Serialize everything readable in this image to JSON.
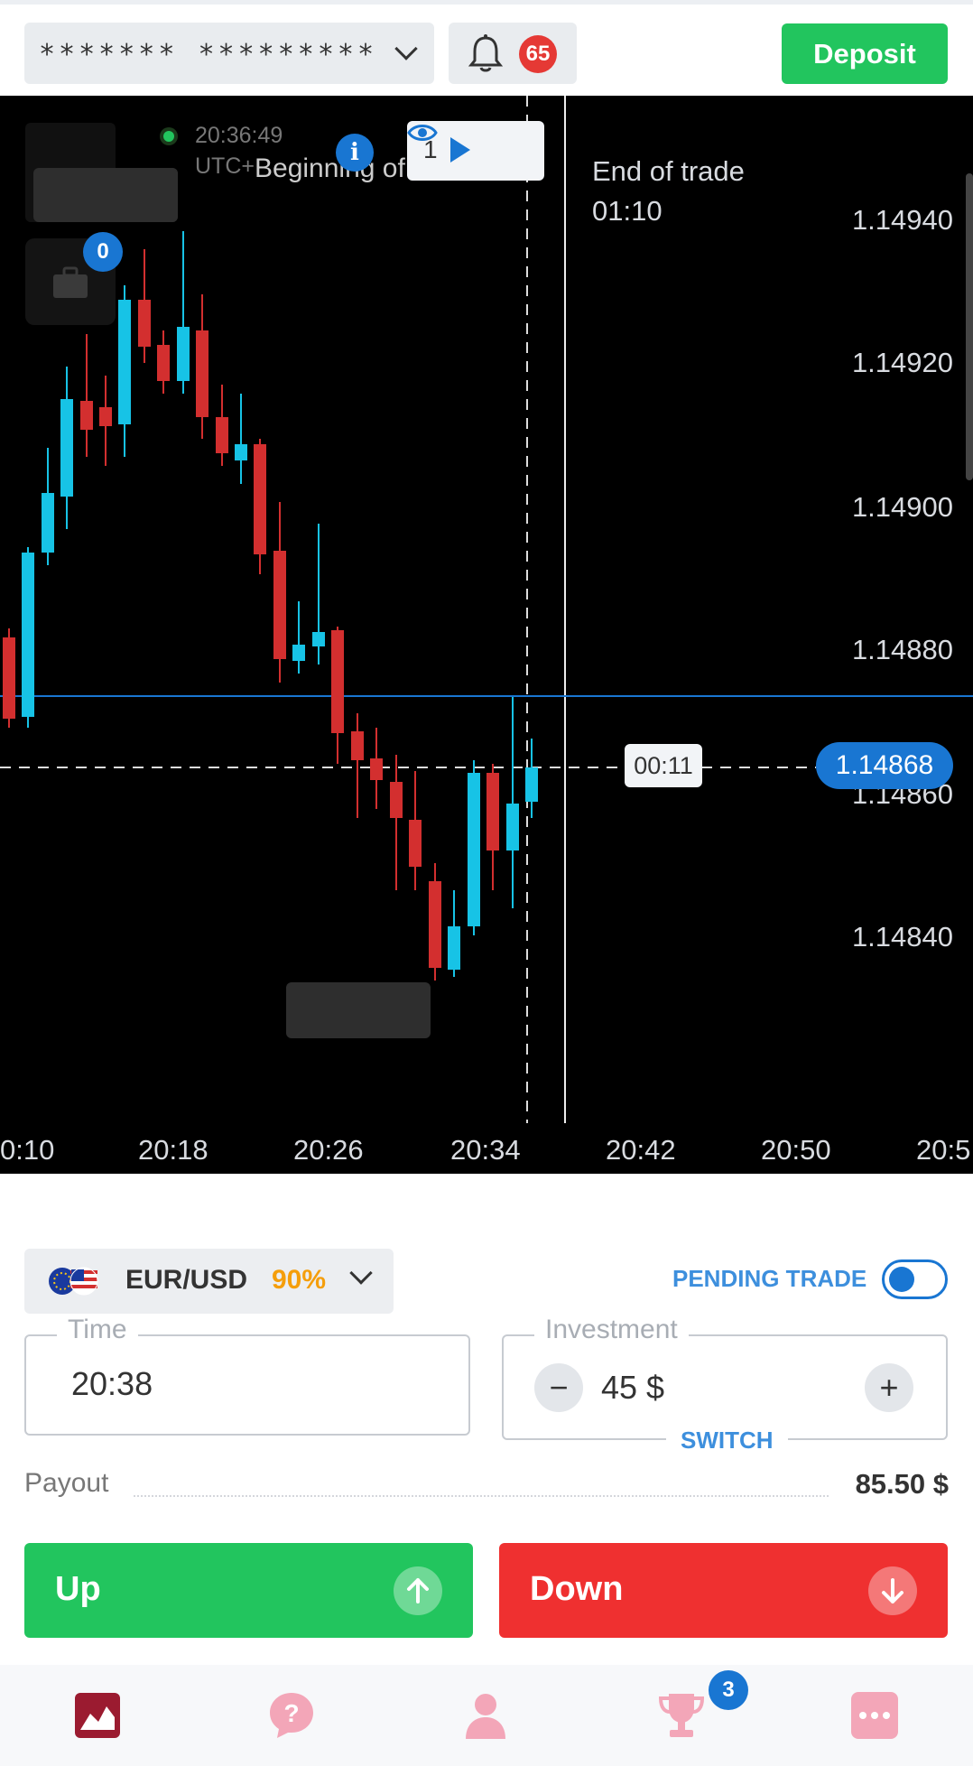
{
  "topbar": {
    "account_masked": "******* *********",
    "notification_count": "65",
    "deposit_label": "Deposit"
  },
  "chart": {
    "clock": "20:36:49",
    "timezone": "UTC+",
    "beginning_label": "Beginning of trade",
    "end_label": "End of trade",
    "end_time": "01:10",
    "trades_count": "1",
    "portfolio_count": "0",
    "timer": "00:11",
    "current_price": "1.14868",
    "price_levels": [
      "1.14940",
      "1.14920",
      "1.14900",
      "1.14880",
      "1.14860",
      "1.14840"
    ],
    "time_labels": [
      "0:10",
      "20:18",
      "20:26",
      "20:34",
      "20:42",
      "20:50",
      "20:5"
    ],
    "colors": {
      "bull": "#17c3e6",
      "bear": "#d32f2f",
      "accent": "#1976d2"
    }
  },
  "asset": {
    "pair": "EUR/USD",
    "payout_pct": "90%"
  },
  "pending": {
    "label": "PENDING TRADE",
    "enabled": false
  },
  "time_field": {
    "label": "Time",
    "value": "20:38"
  },
  "investment_field": {
    "label": "Investment",
    "value": "45 $",
    "switch_label": "SWITCH",
    "minus": "−",
    "plus": "+"
  },
  "payout": {
    "label": "Payout",
    "value": "85.50 $"
  },
  "actions": {
    "up_label": "Up",
    "down_label": "Down"
  },
  "bottom_nav": {
    "items": [
      "chart-icon",
      "help-icon",
      "profile-icon",
      "trophy-icon",
      "more-icon"
    ],
    "trophy_badge": "3"
  }
}
